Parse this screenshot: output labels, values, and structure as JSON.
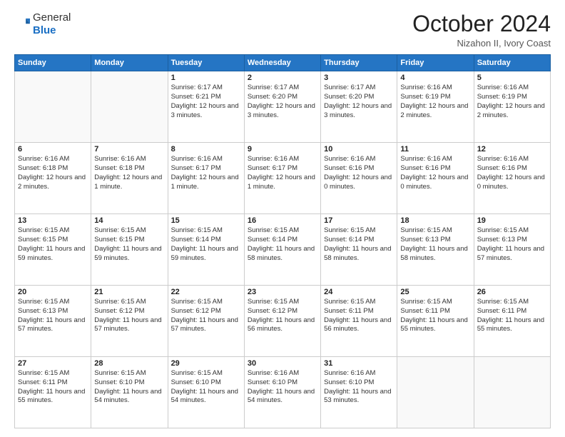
{
  "logo": {
    "general": "General",
    "blue": "Blue"
  },
  "title": "October 2024",
  "location": "Nizahon II, Ivory Coast",
  "days_of_week": [
    "Sunday",
    "Monday",
    "Tuesday",
    "Wednesday",
    "Thursday",
    "Friday",
    "Saturday"
  ],
  "weeks": [
    [
      {
        "day": "",
        "info": ""
      },
      {
        "day": "",
        "info": ""
      },
      {
        "day": "1",
        "info": "Sunrise: 6:17 AM\nSunset: 6:21 PM\nDaylight: 12 hours and 3 minutes."
      },
      {
        "day": "2",
        "info": "Sunrise: 6:17 AM\nSunset: 6:20 PM\nDaylight: 12 hours and 3 minutes."
      },
      {
        "day": "3",
        "info": "Sunrise: 6:17 AM\nSunset: 6:20 PM\nDaylight: 12 hours and 3 minutes."
      },
      {
        "day": "4",
        "info": "Sunrise: 6:16 AM\nSunset: 6:19 PM\nDaylight: 12 hours and 2 minutes."
      },
      {
        "day": "5",
        "info": "Sunrise: 6:16 AM\nSunset: 6:19 PM\nDaylight: 12 hours and 2 minutes."
      }
    ],
    [
      {
        "day": "6",
        "info": "Sunrise: 6:16 AM\nSunset: 6:18 PM\nDaylight: 12 hours and 2 minutes."
      },
      {
        "day": "7",
        "info": "Sunrise: 6:16 AM\nSunset: 6:18 PM\nDaylight: 12 hours and 1 minute."
      },
      {
        "day": "8",
        "info": "Sunrise: 6:16 AM\nSunset: 6:17 PM\nDaylight: 12 hours and 1 minute."
      },
      {
        "day": "9",
        "info": "Sunrise: 6:16 AM\nSunset: 6:17 PM\nDaylight: 12 hours and 1 minute."
      },
      {
        "day": "10",
        "info": "Sunrise: 6:16 AM\nSunset: 6:16 PM\nDaylight: 12 hours and 0 minutes."
      },
      {
        "day": "11",
        "info": "Sunrise: 6:16 AM\nSunset: 6:16 PM\nDaylight: 12 hours and 0 minutes."
      },
      {
        "day": "12",
        "info": "Sunrise: 6:16 AM\nSunset: 6:16 PM\nDaylight: 12 hours and 0 minutes."
      }
    ],
    [
      {
        "day": "13",
        "info": "Sunrise: 6:15 AM\nSunset: 6:15 PM\nDaylight: 11 hours and 59 minutes."
      },
      {
        "day": "14",
        "info": "Sunrise: 6:15 AM\nSunset: 6:15 PM\nDaylight: 11 hours and 59 minutes."
      },
      {
        "day": "15",
        "info": "Sunrise: 6:15 AM\nSunset: 6:14 PM\nDaylight: 11 hours and 59 minutes."
      },
      {
        "day": "16",
        "info": "Sunrise: 6:15 AM\nSunset: 6:14 PM\nDaylight: 11 hours and 58 minutes."
      },
      {
        "day": "17",
        "info": "Sunrise: 6:15 AM\nSunset: 6:14 PM\nDaylight: 11 hours and 58 minutes."
      },
      {
        "day": "18",
        "info": "Sunrise: 6:15 AM\nSunset: 6:13 PM\nDaylight: 11 hours and 58 minutes."
      },
      {
        "day": "19",
        "info": "Sunrise: 6:15 AM\nSunset: 6:13 PM\nDaylight: 11 hours and 57 minutes."
      }
    ],
    [
      {
        "day": "20",
        "info": "Sunrise: 6:15 AM\nSunset: 6:13 PM\nDaylight: 11 hours and 57 minutes."
      },
      {
        "day": "21",
        "info": "Sunrise: 6:15 AM\nSunset: 6:12 PM\nDaylight: 11 hours and 57 minutes."
      },
      {
        "day": "22",
        "info": "Sunrise: 6:15 AM\nSunset: 6:12 PM\nDaylight: 11 hours and 57 minutes."
      },
      {
        "day": "23",
        "info": "Sunrise: 6:15 AM\nSunset: 6:12 PM\nDaylight: 11 hours and 56 minutes."
      },
      {
        "day": "24",
        "info": "Sunrise: 6:15 AM\nSunset: 6:11 PM\nDaylight: 11 hours and 56 minutes."
      },
      {
        "day": "25",
        "info": "Sunrise: 6:15 AM\nSunset: 6:11 PM\nDaylight: 11 hours and 55 minutes."
      },
      {
        "day": "26",
        "info": "Sunrise: 6:15 AM\nSunset: 6:11 PM\nDaylight: 11 hours and 55 minutes."
      }
    ],
    [
      {
        "day": "27",
        "info": "Sunrise: 6:15 AM\nSunset: 6:11 PM\nDaylight: 11 hours and 55 minutes."
      },
      {
        "day": "28",
        "info": "Sunrise: 6:15 AM\nSunset: 6:10 PM\nDaylight: 11 hours and 54 minutes."
      },
      {
        "day": "29",
        "info": "Sunrise: 6:15 AM\nSunset: 6:10 PM\nDaylight: 11 hours and 54 minutes."
      },
      {
        "day": "30",
        "info": "Sunrise: 6:16 AM\nSunset: 6:10 PM\nDaylight: 11 hours and 54 minutes."
      },
      {
        "day": "31",
        "info": "Sunrise: 6:16 AM\nSunset: 6:10 PM\nDaylight: 11 hours and 53 minutes."
      },
      {
        "day": "",
        "info": ""
      },
      {
        "day": "",
        "info": ""
      }
    ]
  ]
}
